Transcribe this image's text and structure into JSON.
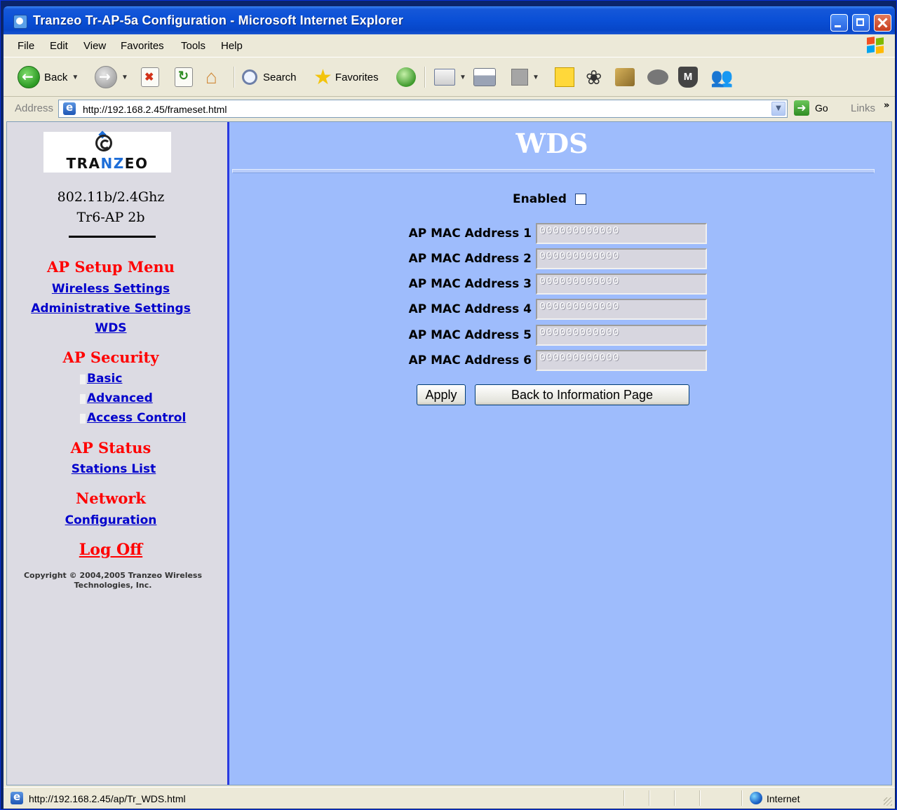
{
  "window": {
    "title": "Tranzeo Tr-AP-5a Configuration - Microsoft Internet Explorer"
  },
  "menu": [
    "File",
    "Edit",
    "View",
    "Favorites",
    "Tools",
    "Help"
  ],
  "toolbar": {
    "back_label": "Back",
    "search_label": "Search",
    "favorites_label": "Favorites"
  },
  "address": {
    "label": "Address",
    "url": "http://192.168.2.45/frameset.html",
    "go_label": "Go",
    "links_label": "Links"
  },
  "sidebar": {
    "logo_text_pre": "TRA",
    "logo_text_nz": "NZ",
    "logo_text_post": "EO",
    "model_line1": "802.11b/2.4Ghz",
    "model_line2": "Tr6-AP 2b",
    "setup_menu_heading": "AP Setup Menu",
    "setup_links": [
      "Wireless Settings",
      "Administrative Settings",
      "WDS"
    ],
    "security_heading": "AP Security",
    "security_links": [
      "Basic",
      "Advanced",
      "Access Control"
    ],
    "status_heading": "AP Status",
    "status_links": [
      "Stations List"
    ],
    "network_heading": "Network",
    "network_links": [
      "Configuration"
    ],
    "logoff_label": "Log Off",
    "copyright": "Copyright © 2004,2005 Tranzeo Wireless Technologies, Inc."
  },
  "main": {
    "title": "WDS",
    "enabled_label": "Enabled",
    "enabled_checked": false,
    "mac_fields": [
      {
        "label": "AP MAC Address 1",
        "value": "000000000000"
      },
      {
        "label": "AP MAC Address 2",
        "value": "000000000000"
      },
      {
        "label": "AP MAC Address 3",
        "value": "000000000000"
      },
      {
        "label": "AP MAC Address 4",
        "value": "000000000000"
      },
      {
        "label": "AP MAC Address 5",
        "value": "000000000000"
      },
      {
        "label": "AP MAC Address 6",
        "value": "000000000000"
      }
    ],
    "apply_label": "Apply",
    "back_label": "Back to Information Page"
  },
  "status": {
    "url": "http://192.168.2.45/ap/Tr_WDS.html",
    "zone": "Internet"
  },
  "colors": {
    "left_frame_bg": "#dcdbe3",
    "right_frame_bg": "#9ebcfc",
    "heading_red": "#ff0000",
    "link_blue": "#0000cc"
  }
}
